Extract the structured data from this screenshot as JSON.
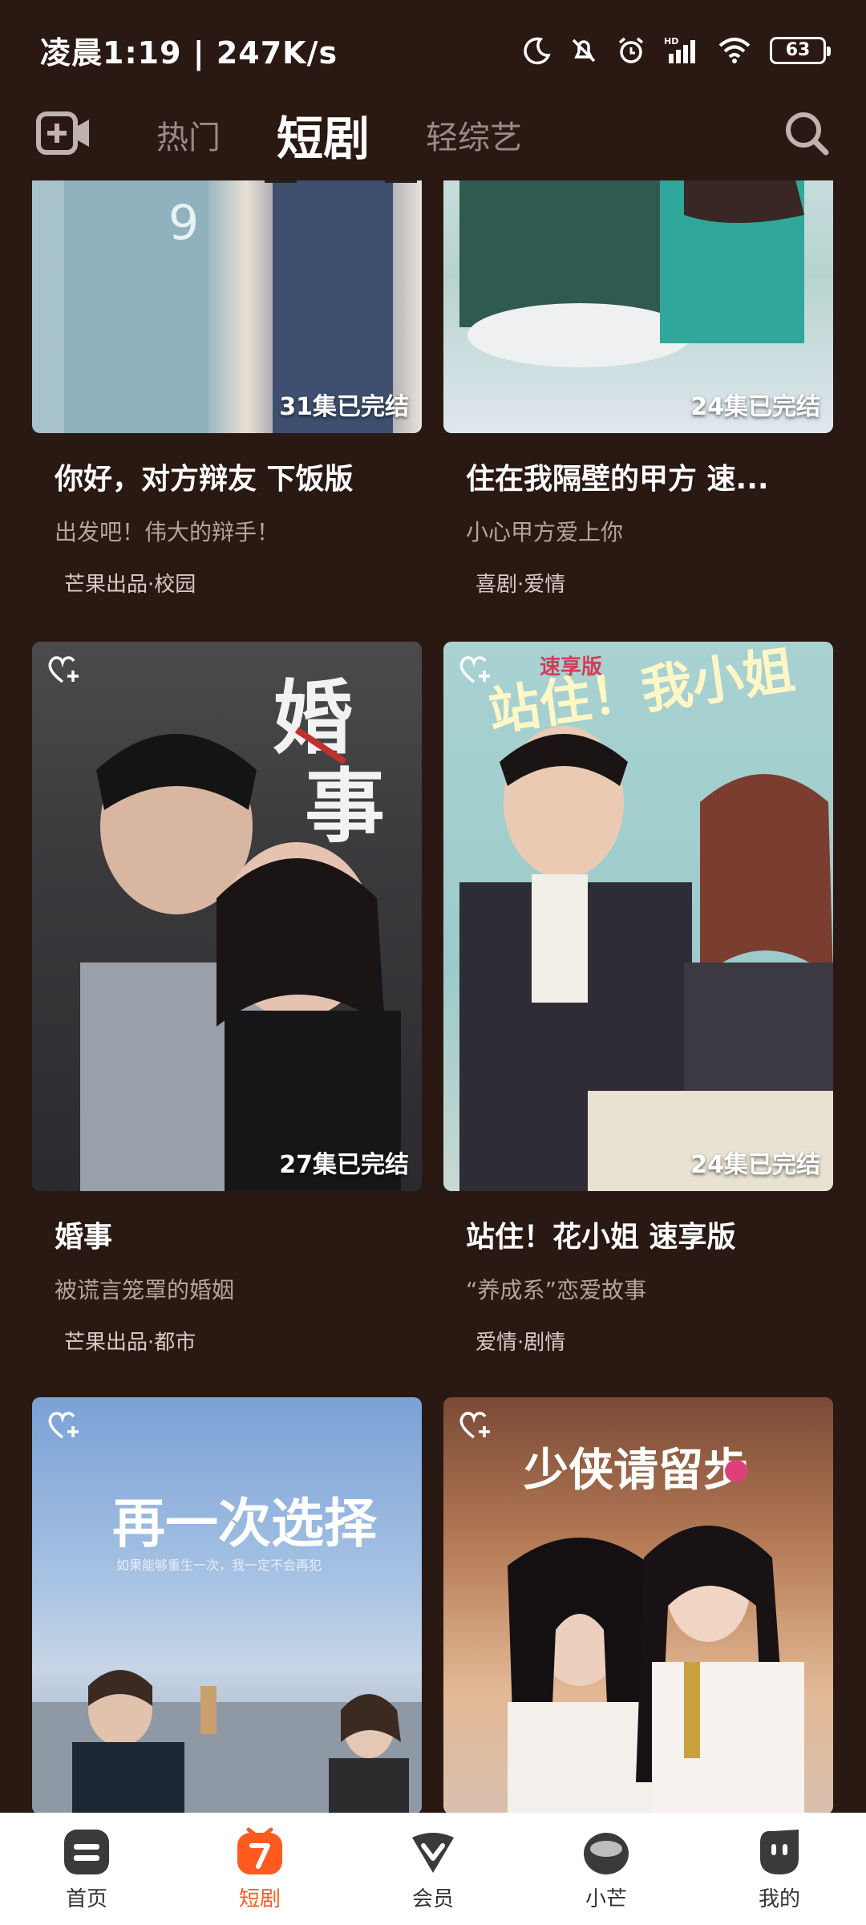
{
  "status": {
    "time_speed": "凌晨1:19 | 247K/s",
    "battery": "63"
  },
  "nav": {
    "tabs": [
      {
        "label": "热门",
        "active": false
      },
      {
        "label": "短剧",
        "active": true
      },
      {
        "label": "轻综艺",
        "active": false
      }
    ]
  },
  "cards": [
    {
      "title": "你好，对方辩友 下饭版",
      "subtitle": "出发吧！伟大的辩手！",
      "tags": "芒果出品·校园",
      "episodes": "31集已完结"
    },
    {
      "title": "住在我隔壁的甲方 速...",
      "subtitle": "小心甲方爱上你",
      "tags": "喜剧·爱情",
      "episodes": "24集已完结"
    },
    {
      "title": "婚事",
      "subtitle": "被谎言笼罩的婚姻",
      "tags": "芒果出品·都市",
      "episodes": "27集已完结"
    },
    {
      "title": "站住！花小姐 速享版",
      "subtitle": "“养成系”恋爱故事",
      "tags": "爱情·剧情",
      "episodes": "24集已完结"
    },
    {
      "title": "",
      "subtitle": "",
      "tags": "",
      "episodes": ""
    },
    {
      "title": "",
      "subtitle": "",
      "tags": "",
      "episodes": ""
    }
  ],
  "posters": {
    "hunshi_title": "婚事",
    "zhanzhu_title": "站住！我小姐",
    "zhanzhu_tag": "速享版",
    "zaiyici_title": "再一次选择",
    "zaiyici_tagline": "如果能够重生一次，我一定不会再犯",
    "shaoxia_title": "少侠请留步"
  },
  "bottom_nav": [
    {
      "label": "首页",
      "icon": "home-icon"
    },
    {
      "label": "短剧",
      "icon": "short-drama-icon"
    },
    {
      "label": "会员",
      "icon": "vip-icon"
    },
    {
      "label": "小芒",
      "icon": "xiaomang-icon"
    },
    {
      "label": "我的",
      "icon": "profile-icon"
    }
  ],
  "colors": {
    "background": "#2a1813",
    "accent": "#ff5a1f",
    "muted_text": "#b3a49d"
  }
}
